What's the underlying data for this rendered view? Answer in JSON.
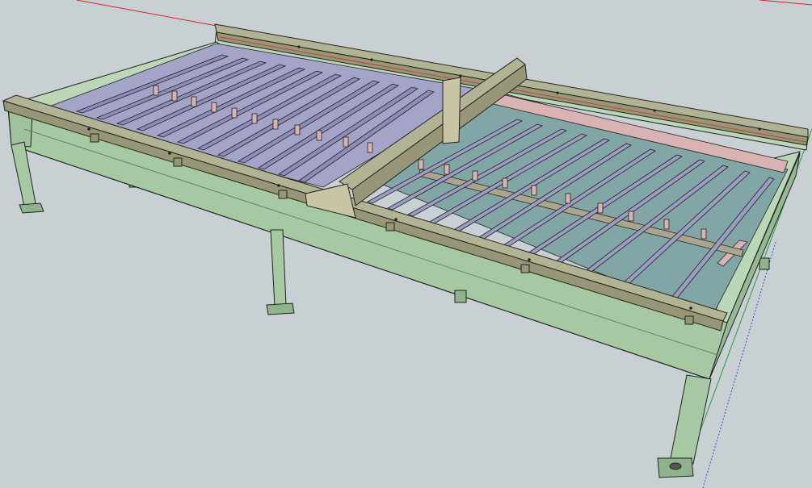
{
  "app": {
    "type": "3d-modeling-viewport",
    "subject": "cnc-plasma-table-model"
  },
  "colors": {
    "background": "#c9d0d4",
    "frame_face": "#a6c9a4",
    "frame_top": "#bcd7b8",
    "frame_dark": "#8fb38c",
    "rail_top": "#b2b394",
    "rail_face": "#979777",
    "slat": "#9c9cc4",
    "slat_dark": "#7d7da8",
    "water_tray": "#82a5a6",
    "pink_ledge": "#d9b3b3",
    "axis_red": "#e0202a",
    "axis_green": "#1f9e3a",
    "axis_blue": "#2a56d6",
    "edge": "#222222"
  }
}
